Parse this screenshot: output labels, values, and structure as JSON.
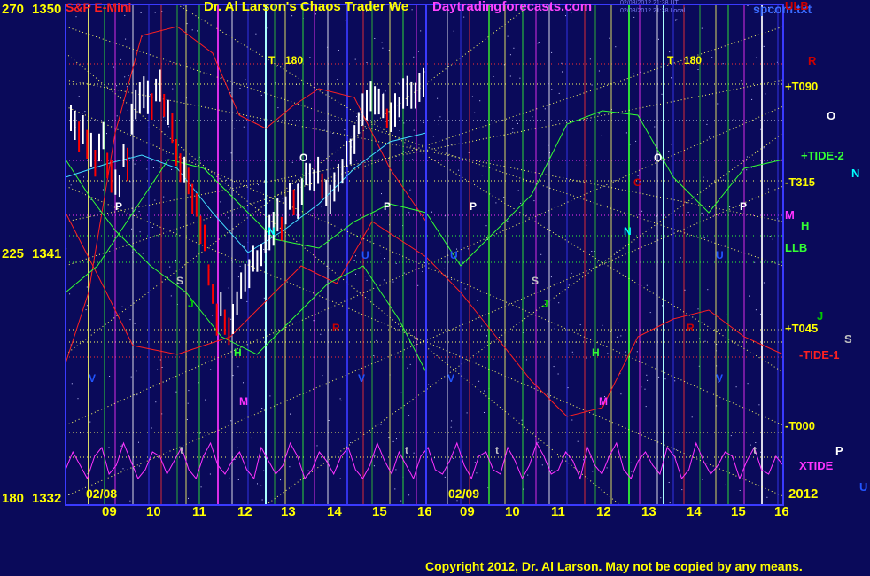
{
  "header": {
    "left_title": "S&P E-Mini",
    "main_title": "Dr. Al Larson's Chaos Trader We",
    "site": "Daytradingforecasts.com",
    "file": "spcom.txt",
    "tiny_stamp_1": "02/08/2012 21:38 UT",
    "tiny_stamp_2": "02/08/2012 21:38 Local"
  },
  "y_labels": [
    {
      "level": "270",
      "price": "1350"
    },
    {
      "level": "225",
      "price": "1341"
    },
    {
      "level": "180",
      "price": "1332"
    }
  ],
  "x_labels": {
    "hours": [
      "09",
      "10",
      "11",
      "12",
      "13",
      "14",
      "15",
      "16",
      "09",
      "10",
      "11",
      "12",
      "13",
      "14",
      "15",
      "16"
    ],
    "date_1": "02/08",
    "date_2": "02/09",
    "year": "2012"
  },
  "right_labels": [
    "ULB",
    "R",
    "+T090",
    "O",
    "+TIDE-2",
    "N",
    "-T315",
    "M",
    "H",
    "LLB",
    "J",
    "+T045",
    "S",
    "-TIDE-1",
    "-T000",
    "P",
    "XTIDE",
    "U"
  ],
  "markers": [
    "T",
    "180",
    "T",
    "180",
    "O",
    "O",
    "P",
    "P",
    "P",
    "P",
    "S",
    "S",
    "J",
    "J",
    "H",
    "H",
    "M",
    "M",
    "R",
    "R",
    "N",
    "C",
    "N",
    "V",
    "V",
    "V",
    "V",
    "U",
    "U",
    "U",
    "t",
    "t",
    "t",
    "t"
  ],
  "footer": {
    "copyright": "Copyright 2012, Dr. Al Larson. May not be copied by any means."
  },
  "colors": {
    "background": "#0a0a5a",
    "frame": "#3a3aff",
    "price_bar_up": "#ffffff",
    "price_bar_down": "#ff0000",
    "tide": "#ff33ff",
    "grid_yellow": "#ffff66",
    "copyright": "#ffff00"
  },
  "chart_data": {
    "type": "line",
    "title": "S&P E-Mini",
    "y_price_range": [
      1332,
      1350
    ],
    "y_level_range": [
      180,
      270
    ],
    "x_sessions": [
      "02/08",
      "02/09"
    ],
    "price_series": [
      1345.8,
      1345.6,
      1345.2,
      1345.4,
      1345.0,
      1344.8,
      1344.4,
      1344.9,
      1345.2,
      1344.1,
      1343.8,
      1343.7,
      1343.5,
      1344.6,
      1344.2,
      1345.9,
      1346.4,
      1346.6,
      1346.9,
      1346.7,
      1346.4,
      1346.9,
      1347.1,
      1346.4,
      1346.2,
      1345.5,
      1344.8,
      1344.2,
      1344.0,
      1343.7,
      1343.1,
      1342.8,
      1342.0,
      1341.6,
      1340.3,
      1339.6,
      1338.6,
      1339.2,
      1338.6,
      1338.3,
      1338.7,
      1339.3,
      1339.8,
      1340.3,
      1340.2,
      1340.8,
      1340.8,
      1341.0,
      1341.5,
      1341.8,
      1341.9,
      1342.4,
      1342.0,
      1342.5,
      1343.2,
      1342.8,
      1342.9,
      1343.4,
      1343.9,
      1343.7,
      1343.7,
      1343.9,
      1343.4,
      1343.2,
      1343.1,
      1343.4,
      1343.7,
      1344.0,
      1344.6,
      1344.8,
      1345.1,
      1345.7,
      1346.2,
      1346.4,
      1346.8,
      1346.6,
      1346.5,
      1346.4,
      1345.9,
      1346.0,
      1346.2,
      1346.3,
      1346.7,
      1346.8,
      1346.6,
      1346.7,
      1347.0,
      1347.1
    ],
    "tide_series": [
      0.3,
      0.7,
      0.4,
      0.1,
      0.6,
      0.8,
      0.2,
      0.4,
      0.9,
      0.5,
      0.1,
      0.3,
      0.7,
      0.6,
      0.2,
      0.5,
      0.8,
      0.3,
      0.1,
      0.6,
      0.9,
      0.4,
      0.2,
      0.5,
      0.7,
      0.3,
      0.1,
      0.8,
      0.5,
      0.2,
      0.4,
      0.9,
      0.6,
      0.1,
      0.3,
      0.7,
      0.5,
      0.2,
      0.6,
      0.8,
      0.3,
      0.1,
      0.4,
      0.9,
      0.5,
      0.2,
      0.7,
      0.4,
      0.1,
      0.6,
      0.8,
      0.3,
      0.2,
      0.5,
      0.9,
      0.4,
      0.1,
      0.6,
      0.7,
      0.3,
      0.2,
      0.8,
      0.5,
      0.1,
      0.4,
      0.9,
      0.6,
      0.2,
      0.3,
      0.7,
      0.5,
      0.1,
      0.8,
      0.4,
      0.2,
      0.6,
      0.9,
      0.3,
      0.1,
      0.5,
      0.7,
      0.4,
      0.2,
      0.8,
      0.6,
      0.1,
      0.3,
      0.9,
      0.5,
      0.2,
      0.4,
      0.7,
      0.6,
      0.1,
      0.5,
      0.8,
      0.3,
      0.2,
      0.6,
      0.4
    ]
  }
}
